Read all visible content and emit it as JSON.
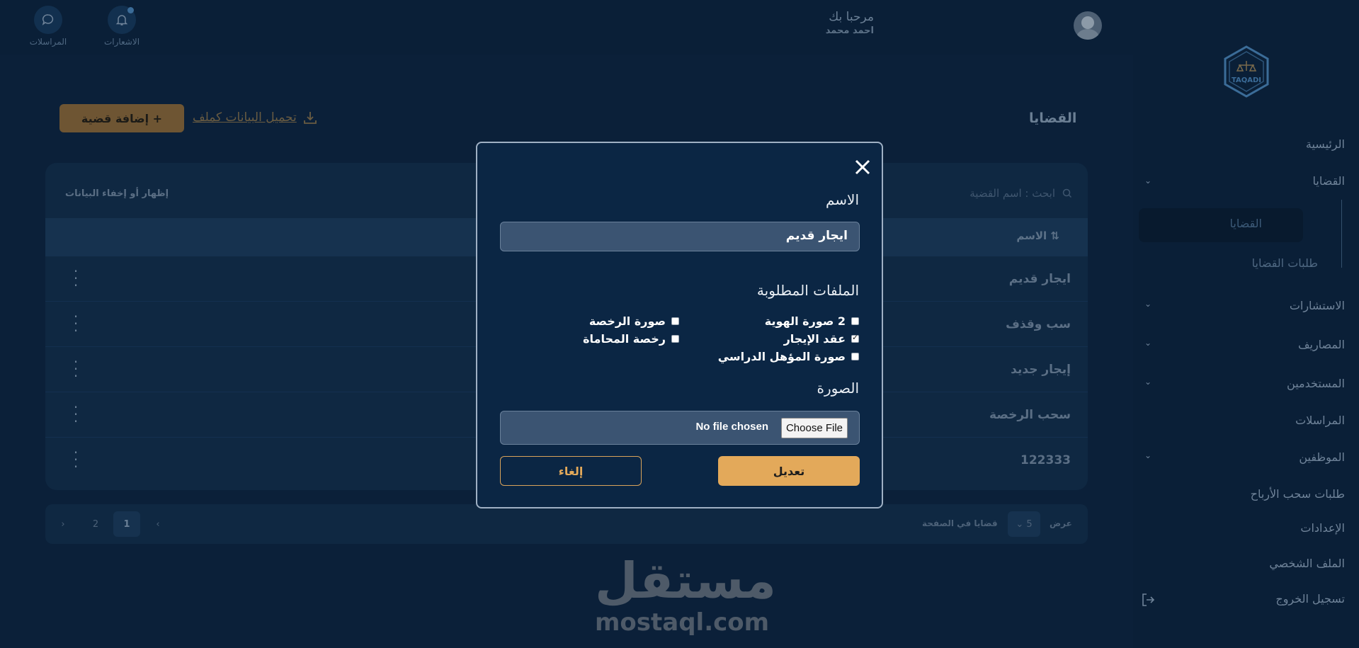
{
  "topbar": {
    "messages_label": "المراسلات",
    "notifications_label": "الاشعارات",
    "greeting": "مرحبا بك",
    "user_name": "احمد محمد"
  },
  "sidebar": {
    "logo_text": "TAQADI",
    "items": [
      {
        "label": "الرئيسية"
      },
      {
        "label": "القضايا"
      },
      {
        "label": "القضايا"
      },
      {
        "label": "طلبات القضايا"
      },
      {
        "label": "الاستشارات"
      },
      {
        "label": "المصاريف"
      },
      {
        "label": "المستخدمين"
      },
      {
        "label": "المراسلات"
      },
      {
        "label": "الموظفين"
      },
      {
        "label": "طلبات سحب الأرباح"
      },
      {
        "label": "الإعدادات"
      },
      {
        "label": "الملف الشخصي"
      },
      {
        "label": "تسجيل الخروج"
      }
    ]
  },
  "main": {
    "title": "القضايا",
    "add_button": "إضافة قضية +",
    "download_label": "تحميل البيانات كملف",
    "search_placeholder": "ابحث : اسم القضية",
    "toggle_columns": "إظهار أو إخفاء البيانات",
    "column_name": "الاسم",
    "rows": [
      "ايجار قديم",
      "سب وقذف",
      "إيجار جديد",
      "سحب الرخصة",
      "122333"
    ]
  },
  "pagination": {
    "show_label": "عرض",
    "per_page": "5",
    "per_page_label": "قضايا في الصفحة",
    "pages": [
      "1",
      "2"
    ],
    "current": "1",
    "prev": "‹",
    "next": "›"
  },
  "watermark": {
    "arabic": "مستقل",
    "latin": "mostaql.com"
  },
  "modal": {
    "name_label": "الاسم",
    "name_value": "ايجار قديم",
    "files_label": "الملفات المطلوبة",
    "files": [
      {
        "label": "2 صورة الهوية",
        "checked": false
      },
      {
        "label": "صورة الرخصة",
        "checked": false
      },
      {
        "label": "عقد الإيجار",
        "checked": true
      },
      {
        "label": "رخصة المحاماة",
        "checked": false
      },
      {
        "label": "صورة المؤهل الدراسي",
        "checked": false
      }
    ],
    "image_label": "الصورة",
    "choose_file": "Choose File",
    "no_file": "No file chosen",
    "save_button": "تعديل",
    "cancel_button": "إلغاء"
  },
  "colors": {
    "accent": "#e3a95a",
    "background": "#0b2039",
    "modal_bg": "#0b2644"
  }
}
